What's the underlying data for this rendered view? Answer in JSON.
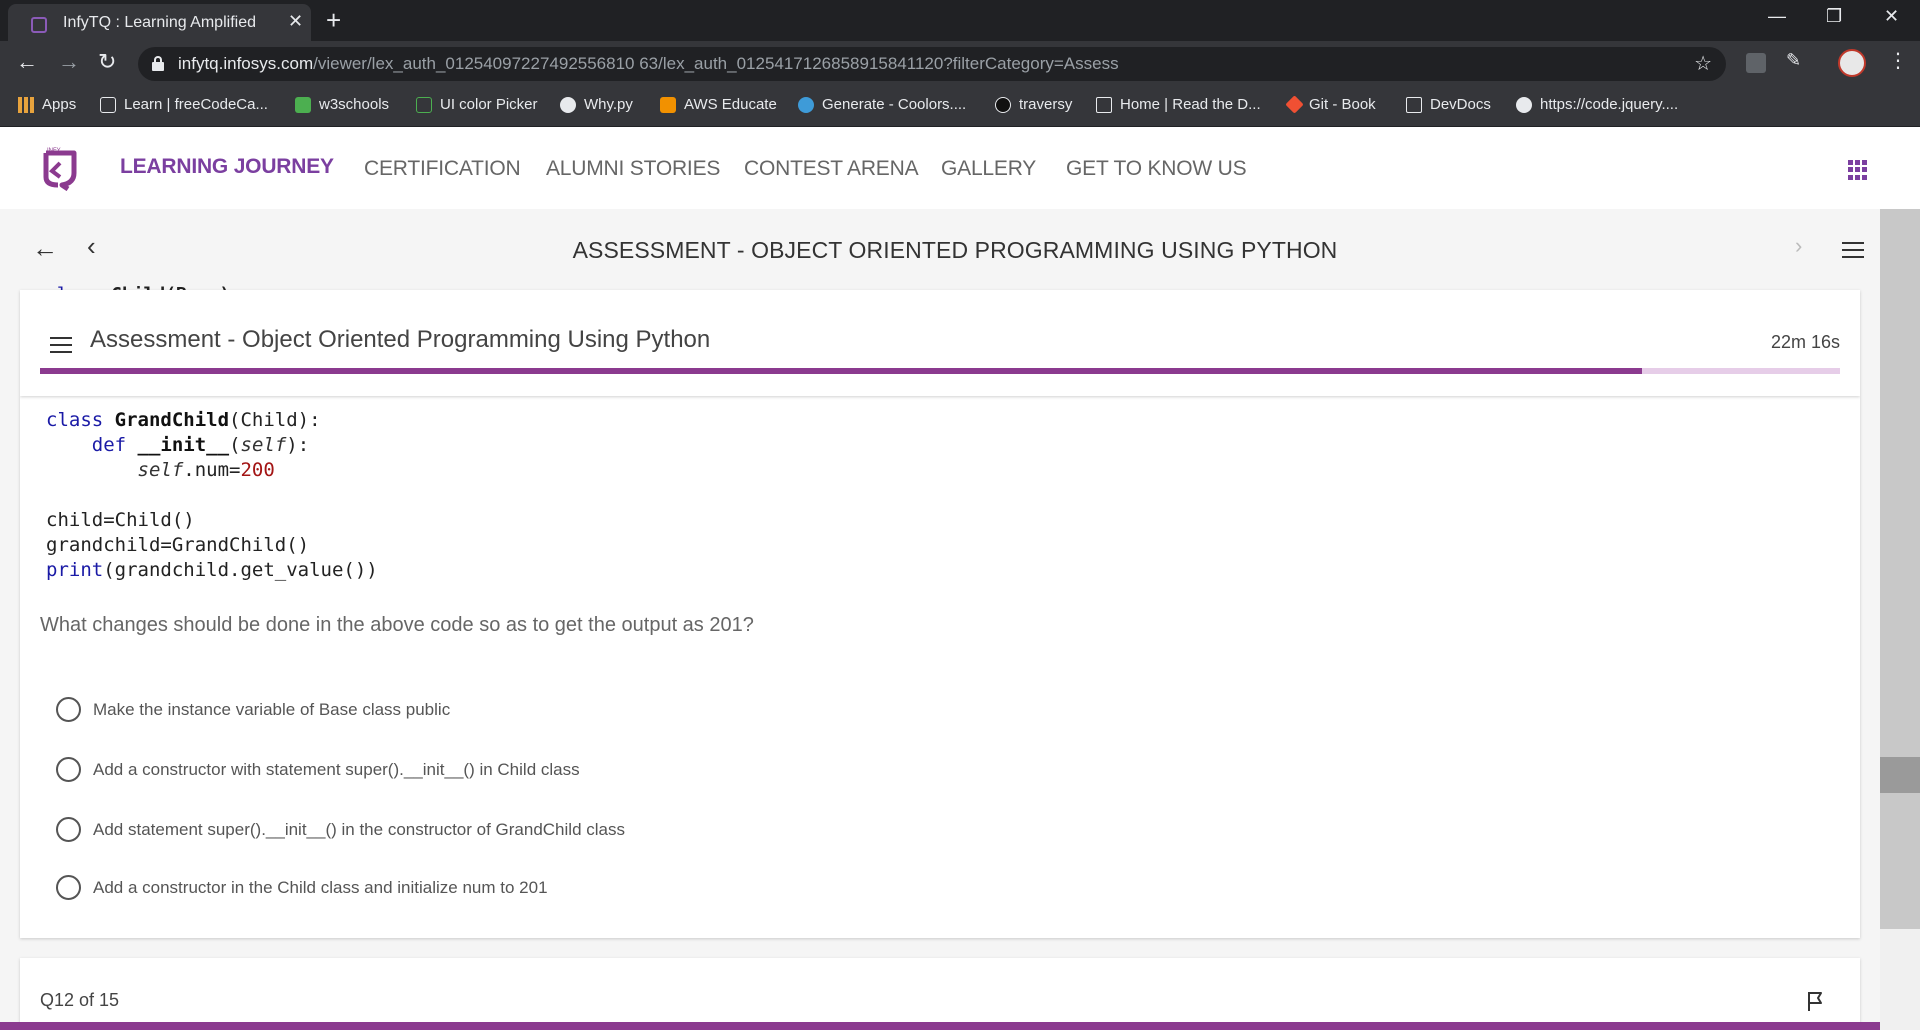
{
  "browser": {
    "tab_title": "InfyTQ : Learning Amplified",
    "url_host": "infytq.infosys.com",
    "url_path": "/viewer/lex_auth_01254097227492556810 63/lex_auth_0125417126858915841120?filterCategory=Assess",
    "bookmarks": [
      {
        "label": "Apps",
        "icon": "apps-grid-icon",
        "color": "#e8a33d"
      },
      {
        "label": "Learn | freeCodeCa...",
        "icon": "freecodecamp-icon",
        "color": "#ffffff"
      },
      {
        "label": "w3schools",
        "icon": "w3schools-icon",
        "color": "#4caf50"
      },
      {
        "label": "UI color Picker",
        "icon": "play-icon",
        "color": "#4caf50"
      },
      {
        "label": "Why.py",
        "icon": "globe-icon",
        "color": "#e8eaed"
      },
      {
        "label": "AWS Educate",
        "icon": "aws-icon",
        "color": "#f29100"
      },
      {
        "label": "Generate - Coolors....",
        "icon": "coolors-icon",
        "color": "#3e9bd8"
      },
      {
        "label": "traversy",
        "icon": "github-icon",
        "color": "#111111"
      },
      {
        "label": "Home | Read the D...",
        "icon": "docs-icon",
        "color": "#e8eaed"
      },
      {
        "label": "Git - Book",
        "icon": "git-icon",
        "color": "#f05033"
      },
      {
        "label": "DevDocs",
        "icon": "devdocs-icon",
        "color": "#e8eaed"
      },
      {
        "label": "https://code.jquery....",
        "icon": "globe-icon",
        "color": "#e8eaed"
      }
    ]
  },
  "site": {
    "logo_text": "INFY",
    "nav": [
      "LEARNING JOURNEY",
      "CERTIFICATION",
      "ALUMNI STORIES",
      "CONTEST ARENA",
      "GALLERY",
      "GET TO KNOW US"
    ],
    "accent": "#7b3fa0"
  },
  "viewer": {
    "title": "ASSESSMENT - OBJECT ORIENTED PROGRAMMING USING PYTHON",
    "peek_kw": "class",
    "peek_rest": " Child(Base):"
  },
  "assessment": {
    "title": "Assessment - Object Oriented Programming Using Python",
    "timer": "22m 16s",
    "progress": 0.89
  },
  "code": {
    "l1_kw": "class",
    "l1_name": " GrandChild",
    "l1_rest": "(Child):",
    "l2_kw": "def",
    "l2_name": "__init__",
    "l2_open": "(",
    "l2_self": "self",
    "l2_close": "):",
    "l3_self": "self",
    "l3_attr": ".num=",
    "l3_val": "200",
    "l4": "child=Child()",
    "l5": "grandchild=GrandChild()",
    "l6_fn": "print",
    "l6_rest": "(grandchild.get_value())"
  },
  "question": {
    "text": "What changes should be done in the above code so as to get the output as 201?",
    "options": [
      "Make the instance variable of Base class public",
      "Add a constructor with statement super().__init__() in Child class",
      "Add statement super().__init__() in the constructor of GrandChild class",
      "Add a constructor in the Child class and initialize num to 201"
    ]
  },
  "footer": {
    "counter": "Q12 of 15"
  }
}
